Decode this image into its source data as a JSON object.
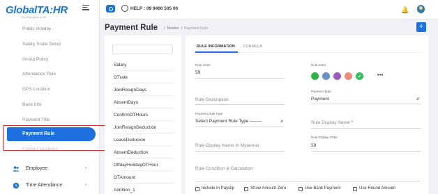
{
  "brand": {
    "logo_main": "Global",
    "logo_accent": "TA:HR",
    "logo_tagline": "Time Attendance & HR"
  },
  "header": {
    "help_text": "HELP : 09 9400 505 00"
  },
  "sidebar": {
    "items": [
      {
        "label": "Public Holiday"
      },
      {
        "label": "Salary Scale Setup"
      },
      {
        "label": "Group Policy"
      },
      {
        "label": "Attendance Rule"
      },
      {
        "label": "GPS Location"
      },
      {
        "label": "Bank Info"
      },
      {
        "label": "Payment Title"
      },
      {
        "label": "Payment Rule"
      },
      {
        "label": "Custom Variables"
      }
    ],
    "sections": [
      {
        "label": "Employee",
        "icon": "people-icon"
      },
      {
        "label": "Time Attendance",
        "icon": "clock-icon"
      }
    ]
  },
  "page": {
    "title": "Payment Rule",
    "breadcrumb": [
      "Master",
      "Payment Rule"
    ],
    "add_button": "+"
  },
  "rule_list": [
    "Salary",
    "OTrate",
    "JoinResignDays",
    "AbsentDays",
    "ConfirmOTHours",
    "JoinResignDeduction",
    "LeaveDeducion",
    "AbsentDeduction",
    "OffdayHolidayOTHour",
    "OTAmount",
    "Addition_1"
  ],
  "tabs": [
    {
      "label": "RULE INFORMATION",
      "active": true
    },
    {
      "label": "FORMULA",
      "active": false
    }
  ],
  "form": {
    "rule_order": {
      "label": "Rule Order",
      "value": "59"
    },
    "rule_color": {
      "label": "Rule Color",
      "colors": [
        "#2fb344",
        "#6c8fc7",
        "#9c5bbf",
        "#f08a78",
        "#2fc05a"
      ],
      "selected_index": 4
    },
    "rule_description": {
      "placeholder": "Rule Description"
    },
    "payment_type": {
      "label": "Payment Type",
      "value": "Payment"
    },
    "payment_rule_type": {
      "label": "Payment Rule Type",
      "value": "Select Payment Rule Type --------"
    },
    "rule_display_name": {
      "placeholder": "Rule Display Name",
      "required_mark": "*"
    },
    "rule_display_name_mm": {
      "placeholder": "Rule Display Name In Myanmar"
    },
    "rule_display_order": {
      "label": "Rule Display Order",
      "value": "59"
    },
    "rule_condition": {
      "placeholder": "Rule Condition & Calculation"
    },
    "checkboxes": [
      {
        "label": "Include In Payslip",
        "checked": false
      },
      {
        "label": "Show Amount Zero",
        "checked": false
      },
      {
        "label": "Use Bank Payment",
        "checked": false
      },
      {
        "label": "Use Round Amount",
        "checked": false
      }
    ]
  },
  "accent_color": "#1e6fe0",
  "highlight_color": "#d32f2f"
}
